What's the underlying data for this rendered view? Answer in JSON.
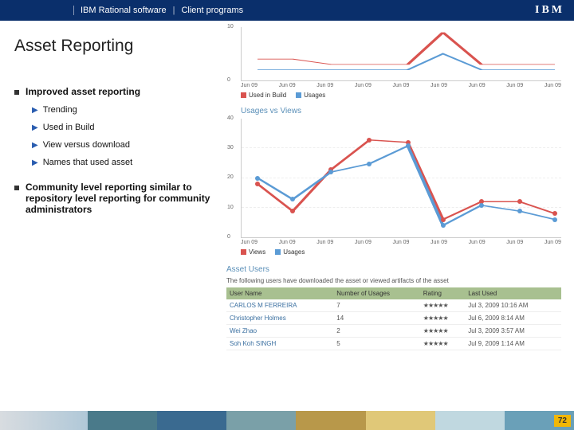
{
  "header": {
    "brand": "IBM Rational software",
    "sep": "|",
    "section": "Client programs",
    "logo": "IBM"
  },
  "title": "Asset Reporting",
  "bullets": {
    "b1": "Improved asset reporting",
    "subs": {
      "s1": "Trending",
      "s2": "Used in Build",
      "s3": "View versus download",
      "s4": "Names that used asset"
    },
    "b2": "Community level reporting similar to repository level reporting for community administrators"
  },
  "charts": {
    "top": {
      "y0": "0",
      "y1": "10",
      "x": {
        "a": "Jun 09",
        "b": "Jun 09",
        "c": "Jun 09",
        "d": "Jun 09",
        "e": "Jun 09",
        "f": "Jun 09",
        "g": "Jun 09",
        "h": "Jun 09",
        "i": "Jun 09"
      },
      "legend": {
        "l1": "Used in Build",
        "l2": "Usages"
      },
      "c1": "#d9534f",
      "c2": "#5b9bd5"
    },
    "main": {
      "title": "Usages vs Views",
      "y": {
        "a": "0",
        "b": "10",
        "c": "20",
        "d": "30",
        "e": "40"
      },
      "x": {
        "a": "Jun 09",
        "b": "Jun 09",
        "c": "Jun 09",
        "d": "Jun 09",
        "e": "Jun 09",
        "f": "Jun 09",
        "g": "Jun 09",
        "h": "Jun 09",
        "i": "Jun 09"
      },
      "legend": {
        "l1": "Views",
        "l2": "Usages"
      },
      "c1": "#d9534f",
      "c2": "#5b9bd5"
    }
  },
  "chart_data": [
    {
      "type": "line",
      "title": "",
      "xlabel": "",
      "ylabel": "",
      "categories": [
        "Jun 09",
        "Jun 09",
        "Jun 09",
        "Jun 09",
        "Jun 09",
        "Jun 09",
        "Jun 09",
        "Jun 09",
        "Jun 09"
      ],
      "series": [
        {
          "name": "Used in Build",
          "values": [
            4,
            4,
            3,
            3,
            3,
            9,
            3,
            3,
            3
          ]
        },
        {
          "name": "Usages",
          "values": [
            2,
            2,
            2,
            2,
            2,
            5,
            2,
            2,
            2
          ]
        }
      ],
      "ylim": [
        0,
        10
      ]
    },
    {
      "type": "line",
      "title": "Usages vs Views",
      "xlabel": "",
      "ylabel": "",
      "categories": [
        "Jun 09",
        "Jun 09",
        "Jun 09",
        "Jun 09",
        "Jun 09",
        "Jun 09",
        "Jun 09",
        "Jun 09",
        "Jun 09"
      ],
      "series": [
        {
          "name": "Views",
          "values": [
            18,
            9,
            23,
            33,
            32,
            6,
            12,
            12,
            8
          ]
        },
        {
          "name": "Usages",
          "values": [
            20,
            13,
            22,
            25,
            31,
            4,
            11,
            9,
            6
          ]
        }
      ],
      "ylim": [
        0,
        40
      ]
    }
  ],
  "users": {
    "title": "Asset Users",
    "desc": "The following users have downloaded the asset or viewed artifacts of the asset",
    "cols": {
      "c1": "User Name",
      "c2": "Number of Usages",
      "c3": "Rating",
      "c4": "Last Used"
    },
    "rows": {
      "r1": {
        "name": "CARLOS M FERREIRA",
        "num": "7",
        "stars": "★★★★★",
        "date": "Jul 3, 2009 10:16 AM"
      },
      "r2": {
        "name": "Christopher Holmes",
        "num": "14",
        "stars": "★★★★★",
        "date": "Jul 6, 2009 8:14 AM"
      },
      "r3": {
        "name": "Wei Zhao",
        "num": "2",
        "stars": "★★★★★",
        "date": "Jul 3, 2009 3:57 AM"
      },
      "r4": {
        "name": "Soh Koh SINGH",
        "num": "5",
        "stars": "★★★★★",
        "date": "Jul 9, 2009 1:14 AM"
      }
    }
  },
  "footer": {
    "page": "72",
    "colors": {
      "a": "#4a7a8a",
      "b": "#3a6a90",
      "c": "#7aa0a8",
      "d": "#b8984a",
      "e": "#e0c878",
      "f": "#c0d8e0",
      "g": "#6aa0b8"
    }
  }
}
